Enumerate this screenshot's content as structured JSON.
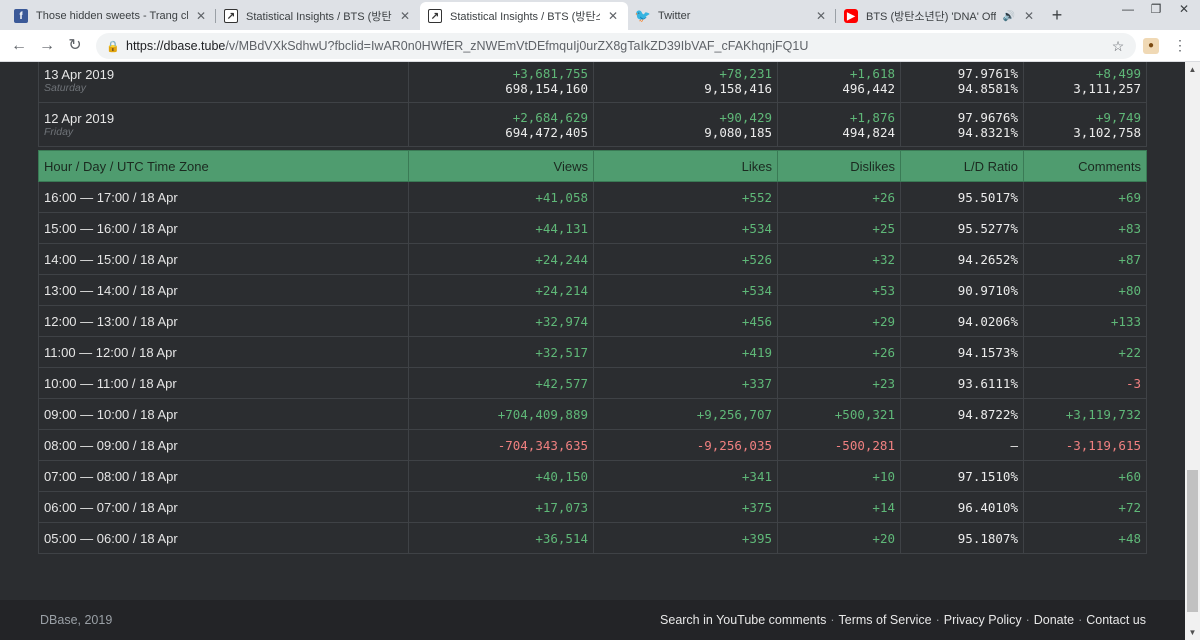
{
  "tabs": [
    {
      "title": "Those hidden sweets - Trang chủ",
      "favicon": "facebook-icon"
    },
    {
      "title": "Statistical Insights / BTS (방탄소년단) 'D",
      "favicon": "chart-icon"
    },
    {
      "title": "Statistical Insights / BTS (방탄소년단) 'D",
      "favicon": "chart-icon"
    },
    {
      "title": "Twitter",
      "favicon": "twitter-icon"
    },
    {
      "title": "BTS (방탄소년단) 'DNA' Official MV",
      "favicon": "youtube-icon"
    }
  ],
  "address_bar": {
    "url_host": "https://dbase.tube",
    "url_path": "/v/MBdVXkSdhwU?fbclid=IwAR0n0HWfER_zNWEmVtDEfmquIj0urZX8gTaIkZD39IbVAF_cFAKhqnjFQ1U"
  },
  "daily": [
    {
      "date": "13 Apr 2019",
      "day": "Saturday",
      "views_delta": "+3,681,755",
      "views_total": "698,154,160",
      "likes_delta": "+78,231",
      "likes_total": "9,158,416",
      "dislikes_delta": "+1,618",
      "dislikes_total": "496,442",
      "ratio_top": "97.9761%",
      "ratio_bottom": "94.8581%",
      "comments_delta": "+8,499",
      "comments_total": "3,111,257"
    },
    {
      "date": "12 Apr 2019",
      "day": "Friday",
      "views_delta": "+2,684,629",
      "views_total": "694,472,405",
      "likes_delta": "+90,429",
      "likes_total": "9,080,185",
      "dislikes_delta": "+1,876",
      "dislikes_total": "494,824",
      "ratio_top": "97.9676%",
      "ratio_bottom": "94.8321%",
      "comments_delta": "+9,749",
      "comments_total": "3,102,758"
    }
  ],
  "hourly_table": {
    "headers": [
      "Hour / Day / UTC Time Zone",
      "Views",
      "Likes",
      "Dislikes",
      "L/D Ratio",
      "Comments"
    ],
    "rows": [
      {
        "hour": "16:00 — 17:00 / 18 Apr",
        "views": "+41,058",
        "likes": "+552",
        "dislikes": "+26",
        "ratio": "95.5017%",
        "comments": "+69"
      },
      {
        "hour": "15:00 — 16:00 / 18 Apr",
        "views": "+44,131",
        "likes": "+534",
        "dislikes": "+25",
        "ratio": "95.5277%",
        "comments": "+83"
      },
      {
        "hour": "14:00 — 15:00 / 18 Apr",
        "views": "+24,244",
        "likes": "+526",
        "dislikes": "+32",
        "ratio": "94.2652%",
        "comments": "+87"
      },
      {
        "hour": "13:00 — 14:00 / 18 Apr",
        "views": "+24,214",
        "likes": "+534",
        "dislikes": "+53",
        "ratio": "90.9710%",
        "comments": "+80"
      },
      {
        "hour": "12:00 — 13:00 / 18 Apr",
        "views": "+32,974",
        "likes": "+456",
        "dislikes": "+29",
        "ratio": "94.0206%",
        "comments": "+133"
      },
      {
        "hour": "11:00 — 12:00 / 18 Apr",
        "views": "+32,517",
        "likes": "+419",
        "dislikes": "+26",
        "ratio": "94.1573%",
        "comments": "+22"
      },
      {
        "hour": "10:00 — 11:00 / 18 Apr",
        "views": "+42,577",
        "likes": "+337",
        "dislikes": "+23",
        "ratio": "93.6111%",
        "comments": "-3"
      },
      {
        "hour": "09:00 — 10:00 / 18 Apr",
        "views": "+704,409,889",
        "likes": "+9,256,707",
        "dislikes": "+500,321",
        "ratio": "94.8722%",
        "comments": "+3,119,732"
      },
      {
        "hour": "08:00 — 09:00 / 18 Apr",
        "views": "-704,343,635",
        "likes": "-9,256,035",
        "dislikes": "-500,281",
        "ratio": "–",
        "comments": "-3,119,615"
      },
      {
        "hour": "07:00 — 08:00 / 18 Apr",
        "views": "+40,150",
        "likes": "+341",
        "dislikes": "+10",
        "ratio": "97.1510%",
        "comments": "+60"
      },
      {
        "hour": "06:00 — 07:00 / 18 Apr",
        "views": "+17,073",
        "likes": "+375",
        "dislikes": "+14",
        "ratio": "96.4010%",
        "comments": "+72"
      },
      {
        "hour": "05:00 — 06:00 / 18 Apr",
        "views": "+36,514",
        "likes": "+395",
        "dislikes": "+20",
        "ratio": "95.1807%",
        "comments": "+48"
      }
    ]
  },
  "footer": {
    "copyright": "DBase, 2019",
    "links": [
      "Search in YouTube comments",
      "Terms of Service",
      "Privacy Policy",
      "Donate",
      "Contact us"
    ]
  },
  "colors": {
    "positive": "#5fb878",
    "negative": "#f08080",
    "header_bg": "#4f9c6f",
    "page_bg": "#2b2d30"
  }
}
